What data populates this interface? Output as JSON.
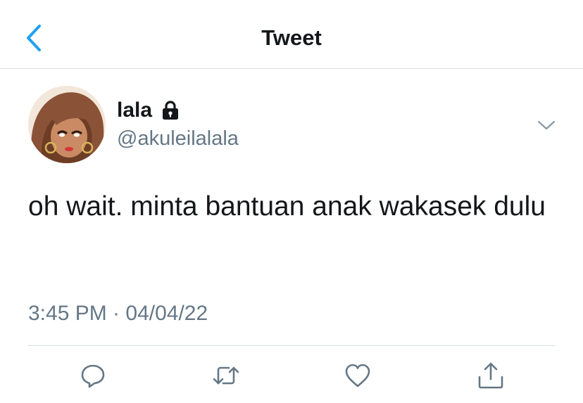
{
  "header": {
    "title": "Tweet",
    "back_icon": "chevron-left-icon",
    "accent": "#1da1f2"
  },
  "tweet": {
    "author": {
      "display_name": "lala",
      "handle": "@akuleilalala",
      "protected_icon": "lock-icon"
    },
    "text": "oh wait. minta bantuan anak wakasek dulu",
    "timestamp": "3:45 PM · 04/04/22"
  },
  "actions": [
    {
      "name": "reply",
      "icon": "comment-icon"
    },
    {
      "name": "retweet",
      "icon": "retweet-icon"
    },
    {
      "name": "like",
      "icon": "heart-icon"
    },
    {
      "name": "share",
      "icon": "share-icon"
    }
  ],
  "colors": {
    "text_primary": "#14171a",
    "text_secondary": "#657786",
    "divider": "#d9dde0",
    "icon_gray": "#657786"
  }
}
